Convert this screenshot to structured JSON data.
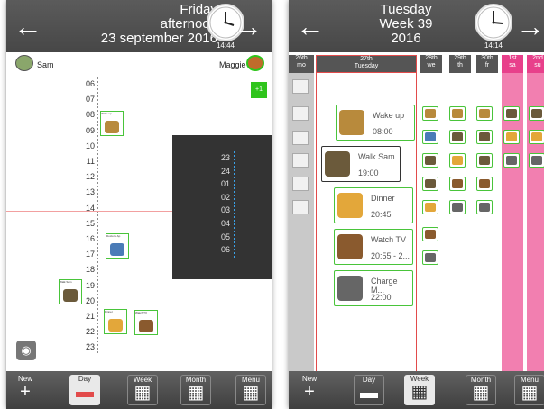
{
  "left": {
    "header": {
      "line1": "Friday",
      "line2": "afternoon",
      "line3": "23 september 2016",
      "clock_time": "14:44"
    },
    "people": {
      "left_name": "Sam",
      "right_name": "Maggie"
    },
    "green_button": "+1",
    "hours": [
      "06",
      "07",
      "08",
      "09",
      "10",
      "11",
      "12",
      "13",
      "14",
      "15",
      "16",
      "17",
      "18",
      "19",
      "20",
      "21",
      "22",
      "23"
    ],
    "night_hours": [
      "23",
      "24",
      "01",
      "02",
      "03",
      "04",
      "05",
      "06"
    ],
    "events": [
      {
        "label": "Wake up",
        "color": "#b88a3c"
      },
      {
        "label": "Doctor's Ap",
        "color": "#4a7bb7"
      },
      {
        "label": "Walk Sam",
        "color": "#6b5a3b"
      },
      {
        "label": "Dinner",
        "color": "#e3a73a"
      },
      {
        "label": "Watch TV",
        "color": "#8a5a2e"
      }
    ],
    "bottom_nav": [
      {
        "label": "New",
        "icon": "+"
      },
      {
        "label": "Day",
        "icon": "▬"
      },
      {
        "label": "Week",
        "icon": "▦"
      },
      {
        "label": "Month",
        "icon": "▦"
      },
      {
        "label": "Menu",
        "icon": "▦"
      }
    ]
  },
  "right": {
    "header": {
      "line1": "Tuesday",
      "line2": "Week 39",
      "line3": "2016",
      "clock_time": "14:14"
    },
    "columns": [
      {
        "label": "26th",
        "sub": "mo",
        "bg": "#555555"
      },
      {
        "label": "27th",
        "sub": "Tuesday",
        "bg": "#555555"
      },
      {
        "label": "28th",
        "sub": "we",
        "bg": "#555555"
      },
      {
        "label": "29th",
        "sub": "th",
        "bg": "#555555"
      },
      {
        "label": "30th",
        "sub": "fr",
        "bg": "#555555"
      },
      {
        "label": "1st",
        "sub": "sa",
        "bg": "#e8408b"
      },
      {
        "label": "2nd",
        "sub": "su",
        "bg": "#e8408b"
      }
    ],
    "events": [
      {
        "title": "Wake up",
        "time": "08:00",
        "color": "#b88a3c"
      },
      {
        "title": "Walk Sam",
        "time": "19:00",
        "color": "#6b5a3b"
      },
      {
        "title": "Dinner",
        "time": "20:45",
        "color": "#e3a73a"
      },
      {
        "title": "Watch TV",
        "time": "20:55 - 2...",
        "color": "#8a5a2e"
      },
      {
        "title": "Charge M...",
        "time": "22:00",
        "color": "#666666"
      }
    ],
    "bottom_nav": [
      {
        "label": "New",
        "icon": "+"
      },
      {
        "label": "Day",
        "icon": "▬"
      },
      {
        "label": "Week",
        "icon": "▦"
      },
      {
        "label": "Month",
        "icon": "▦"
      },
      {
        "label": "Menu",
        "icon": "▦"
      }
    ]
  },
  "colors": {
    "bar_dark": "#4a4a4a",
    "event_border": "#49c43a",
    "weekend_pink": "#f27fb0",
    "today_red": "#e24b4b",
    "night_panel": "#333333"
  }
}
